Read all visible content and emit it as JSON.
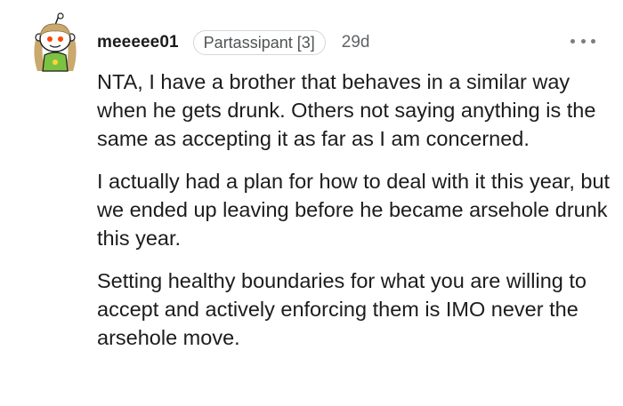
{
  "comment": {
    "username": "meeeee01",
    "flair": "Partassipant [3]",
    "time": "29d",
    "paragraphs": [
      "NTA, I have a brother that behaves in a similar way when he gets drunk. Others not saying anything is the same as accepting it as far as I am concerned.",
      "I actually had a plan for how to deal with it this year, but we ended up leaving before he became arsehole drunk this year.",
      "Setting healthy boundaries for what you are willing to accept and actively enforcing them is IMO never the arsehole move."
    ]
  },
  "icons": {
    "avatar": "user-avatar-icon",
    "more": "more-options-icon"
  },
  "colors": {
    "text": "#1c1c1c",
    "muted": "#606366",
    "flair_border": "#d6d6d6",
    "avatar_hair": "#c9a96e",
    "avatar_shirt": "#7cc242"
  }
}
